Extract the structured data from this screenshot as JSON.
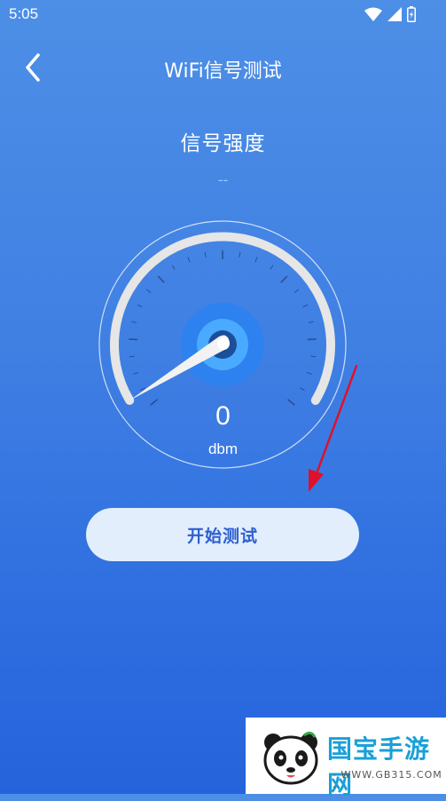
{
  "status_bar": {
    "time": "5:05",
    "icons": [
      "wifi-icon",
      "cellular-signal-icon",
      "battery-icon"
    ]
  },
  "header": {
    "back_icon": "chevron-left-icon",
    "title": "WiFi信号测试"
  },
  "signal": {
    "label": "信号强度",
    "value": "--"
  },
  "gauge": {
    "reading": "0",
    "unit": "dbm"
  },
  "start_button": {
    "label": "开始测试"
  },
  "watermark": {
    "name": "国宝手游网",
    "url": "- WWW.GB315.COM -"
  },
  "colors": {
    "background_top": "#4d8fe6",
    "background_bottom": "#2563dc",
    "button_bg": "#e3eefc",
    "button_text": "#2c5fd0",
    "signal_value": "#7ad8ff",
    "annotation_arrow": "#e0102a"
  }
}
